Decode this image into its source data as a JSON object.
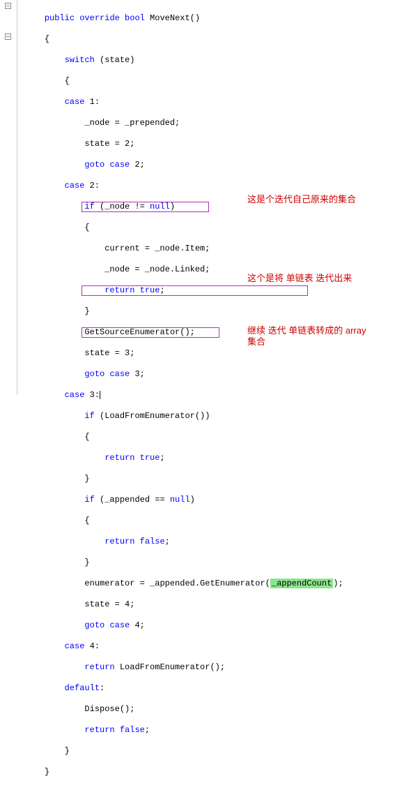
{
  "code": {
    "method_sig_1": "public",
    "method_sig_2": "override",
    "method_sig_3": "bool",
    "method_sig_4": " MoveNext()",
    "lb1": "{",
    "sw1": "switch",
    "sw2": " (state)",
    "lb2": "{",
    "c1a": "case",
    "c1b": " 1:",
    "l1a": "_node = _prepended;",
    "l1b": "state = 2;",
    "l1c_1": "goto",
    "l1c_2": " ",
    "l1c_3": "case",
    "l1c_4": " 2;",
    "c2a": "case",
    "c2b": " 2:",
    "l2a_1": "if",
    "l2a_2": " (_node != ",
    "l2a_3": "null",
    "l2a_4": ")",
    "l2b": "{",
    "l2c": "current = _node.Item;",
    "l2d": "_node = _node.Linked;",
    "l2e_1": "return",
    "l2e_2": " ",
    "l2e_3": "true",
    "l2e_4": ";",
    "l2f": "}",
    "l2g": "GetSourceEnumerator();",
    "l2h": "state = 3;",
    "l2i_1": "goto",
    "l2i_2": " ",
    "l2i_3": "case",
    "l2i_4": " 3;",
    "c3a": "case",
    "c3b": " 3:",
    "l3a_1": "if",
    "l3a_2": " (LoadFromEnumerator())",
    "l3b": "{",
    "l3c_1": "return",
    "l3c_2": " ",
    "l3c_3": "true",
    "l3c_4": ";",
    "l3d": "}",
    "l3e_1": "if",
    "l3e_2": " (_appended == ",
    "l3e_3": "null",
    "l3e_4": ")",
    "l3f": "{",
    "l3g_1": "return",
    "l3g_2": " ",
    "l3g_3": "false",
    "l3g_4": ";",
    "l3h": "}",
    "l3i_1": "enumerator = _appended.GetEnumerator(",
    "l3i_2": "_appendCount",
    "l3i_3": ");",
    "l3j": "state = 4;",
    "l3k_1": "goto",
    "l3k_2": " ",
    "l3k_3": "case",
    "l3k_4": " 4;",
    "c4a": "case",
    "c4b": " 4:",
    "l4a_1": "return",
    "l4a_2": " LoadFromEnumerator();",
    "dfa": "default",
    "dfb": ":",
    "l5a": "Dispose();",
    "l5b_1": "return",
    "l5b_2": " ",
    "l5b_3": "false",
    "l5b_4": ";",
    "rb1": "}",
    "rb2": "}"
  },
  "annotations": {
    "a1": "这是个迭代自己原来的集合",
    "a2": "这个是将 单链表 迭代出来",
    "a3_l1": "继续 迭代 单链表转成的 array",
    "a3_l2": "集合"
  }
}
